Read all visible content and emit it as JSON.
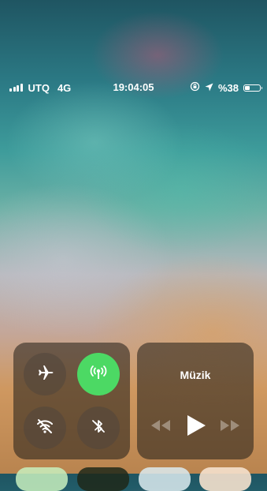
{
  "status_bar": {
    "carrier": "UTQ",
    "network": "4G",
    "time": "19:04:05",
    "battery_text": "%38",
    "battery_level": 0.38,
    "signal_bars": 4,
    "icons": [
      "signal-icon",
      "rotation-lock-icon",
      "location-icon",
      "battery-icon"
    ]
  },
  "connectivity": {
    "airplane_mode": {
      "icon": "airplane-icon",
      "on": false
    },
    "cellular_data": {
      "icon": "cellular-antenna-icon",
      "on": true,
      "color": "#4cd964"
    },
    "wifi": {
      "icon": "wifi-off-icon",
      "on": false
    },
    "bluetooth": {
      "icon": "bluetooth-off-icon",
      "on": false
    }
  },
  "music": {
    "title": "Müzik",
    "controls": [
      "rewind-icon",
      "play-icon",
      "fast-forward-icon"
    ]
  }
}
